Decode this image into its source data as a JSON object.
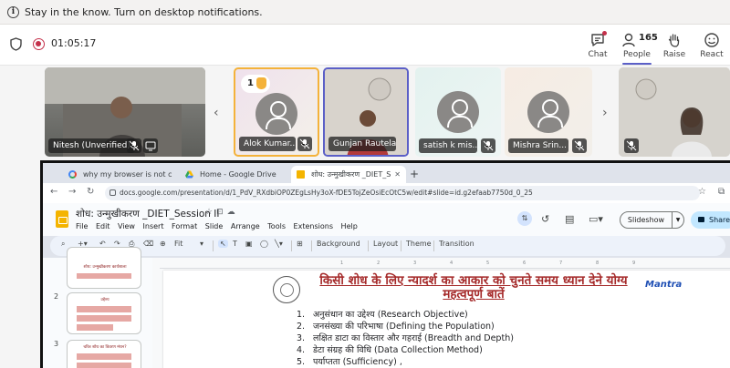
{
  "notification": {
    "text": "Stay in the know. Turn on desktop notifications."
  },
  "meeting": {
    "timer": "01:05:17",
    "buttons": {
      "chat": "Chat",
      "people": "People",
      "people_count": "165",
      "raise": "Raise",
      "react": "React"
    }
  },
  "participants": [
    {
      "name": "Nitesh (Unverified)"
    },
    {
      "name": "Alok Kumar...",
      "hand_count": "1"
    },
    {
      "name": "Gunjan Rautela..."
    },
    {
      "name": "satish k mis..."
    },
    {
      "name": "Mishra Srin..."
    }
  ],
  "browser": {
    "tabs": [
      {
        "title": "why my browser is not c"
      },
      {
        "title": "Home - Google Drive"
      },
      {
        "title": "शोध: उन्मुखीकरण _DIET_S"
      }
    ],
    "url": "docs.google.com/presentation/d/1_PdV_RXdbiOP0ZEgLsHy3oX-fDE5TojZeOsiEcOtC5w/edit#slide=id.g2efaab7750d_0_25"
  },
  "slides_app": {
    "doc_title": "शोध: उन्मुखीकरण _DIET_Session II",
    "menus": [
      "File",
      "Edit",
      "View",
      "Insert",
      "Format",
      "Slide",
      "Arrange",
      "Tools",
      "Extensions",
      "Help"
    ],
    "slideshow_label": "Slideshow",
    "share_label": "Share",
    "toolbar": {
      "fit": "Fit",
      "background": "Background",
      "layout": "Layout",
      "theme": "Theme",
      "transition": "Transition"
    },
    "thumbnails": [
      {
        "number": "",
        "title": "शोध: उन्मुखीकरण कार्यशाला"
      },
      {
        "number": "2",
        "title": "उद्देश्य"
      },
      {
        "number": "3",
        "title": "चरित्र शोध का विवरण मंथन?"
      }
    ]
  },
  "slide": {
    "title": "किसी शोध के लिए न्यादर्श का आकार को चुनते समय ध्यान देने योग्य महत्वपूर्ण बातें",
    "brand": "Mantra",
    "points": [
      {
        "n": "1.",
        "text": "अनुसंधान का उद्देश्य (Research Objective)"
      },
      {
        "n": "2.",
        "text": "जनसंख्या की परिभाषा (Defining the Population)"
      },
      {
        "n": "3.",
        "text": "लक्षित डाटा का विस्तार और गहराई (Breadth and Depth)"
      },
      {
        "n": "4.",
        "text": "डेटा संग्रह की विधि (Data Collection Method)"
      },
      {
        "n": "5.",
        "text": "पर्याप्तता (Sufficiency) ,"
      }
    ]
  },
  "colors": {
    "teams_accent": "#5b5fc7",
    "record_red": "#c4314b",
    "slide_title": "#a52a2a",
    "raised_hand_border": "#f4b23a"
  }
}
